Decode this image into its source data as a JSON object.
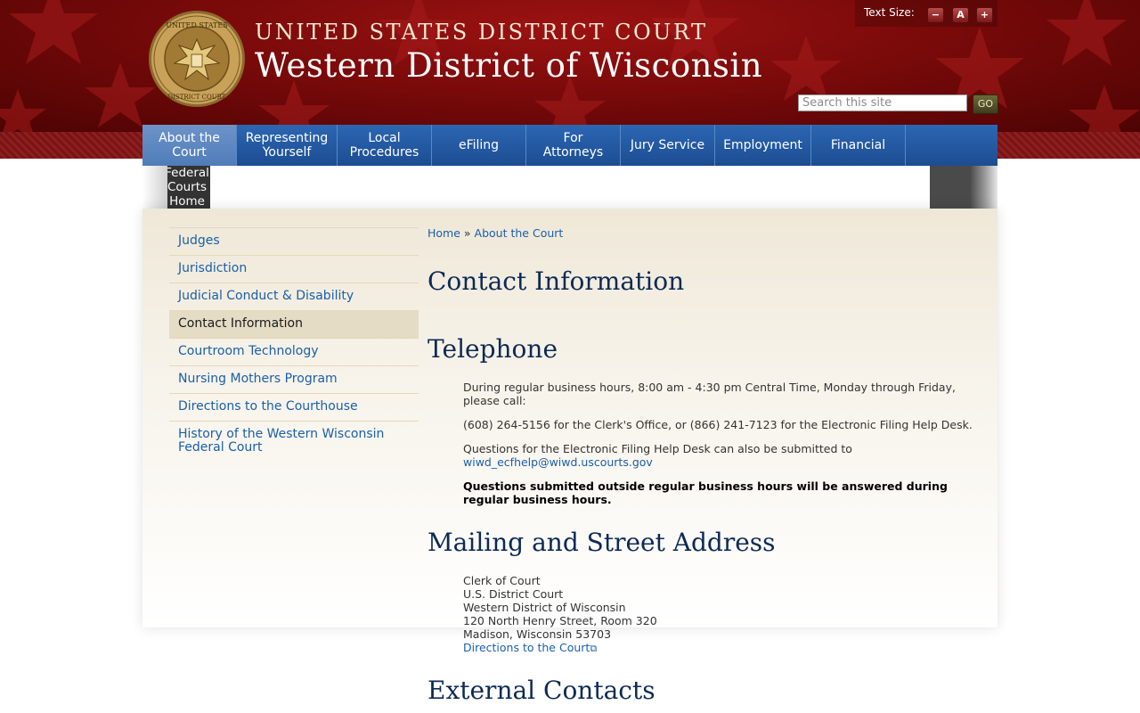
{
  "header": {
    "title_top": "UNITED STATES DISTRICT COURT",
    "title_main": "Western District of Wisconsin",
    "seal_text_top": "UNITED STATES",
    "seal_text_bottom": "DISTRICT COURT",
    "text_size_label": "Text Size:",
    "text_size_buttons": [
      "−",
      "A",
      "+"
    ],
    "search_placeholder": "Search this site",
    "search_button": "GO"
  },
  "nav": {
    "items": [
      {
        "label": "About the\nCourt",
        "active": true
      },
      {
        "label": "Representing\nYourself",
        "active": false
      },
      {
        "label": "Local\nProcedures",
        "active": false
      },
      {
        "label": "eFiling",
        "active": false
      },
      {
        "label": "For\nAttorneys",
        "active": false
      },
      {
        "label": "Jury Service",
        "active": false
      },
      {
        "label": "Employment",
        "active": false
      },
      {
        "label": "Financial",
        "active": false
      }
    ],
    "sub_item": "Federal\nCourts\nHome"
  },
  "sidebar": {
    "items": [
      {
        "label": "Judges",
        "active": false
      },
      {
        "label": "Jurisdiction",
        "active": false
      },
      {
        "label": "Judicial Conduct & Disability",
        "active": false
      },
      {
        "label": "Contact Information",
        "active": true
      },
      {
        "label": "Courtroom Technology",
        "active": false
      },
      {
        "label": "Nursing Mothers Program",
        "active": false
      },
      {
        "label": "Directions to the Courthouse",
        "active": false
      },
      {
        "label": "History of the Western Wisconsin\nFederal Court",
        "active": false
      }
    ]
  },
  "breadcrumb": {
    "home": "Home",
    "separator": "»",
    "current": "About the Court"
  },
  "main": {
    "page_title": "Contact Information",
    "telephone": {
      "heading": "Telephone",
      "p1": "During regular business hours, 8:00 am - 4:30 pm Central Time, Monday through Friday, please call:",
      "p2": "(608) 264-5156 for the Clerk's Office, or (866) 241-7123 for the Electronic Filing Help Desk.",
      "p3": "Questions for the Electronic Filing Help Desk can also be submitted to",
      "p3_email": "wiwd_ecfhelp@wiwd.uscourts.gov",
      "p4": "Questions submitted outside regular business hours will be answered during regular business hours."
    },
    "mailing": {
      "heading": "Mailing and Street Address",
      "lines": [
        "Clerk of Court",
        "U.S. District Court",
        "Western District of Wisconsin",
        "120 North Henry Street, Room 320",
        "Madison, Wisconsin 53703"
      ],
      "directions_link": "Directions to the Court"
    },
    "external": {
      "heading": "External Contacts"
    }
  },
  "colors": {
    "header_red": "#7a0a0a",
    "nav_blue": "#1c4d92",
    "link_blue": "#1a5fa8",
    "heading_navy": "#0d2a55",
    "sidebar_active": "#e4dcc5"
  }
}
